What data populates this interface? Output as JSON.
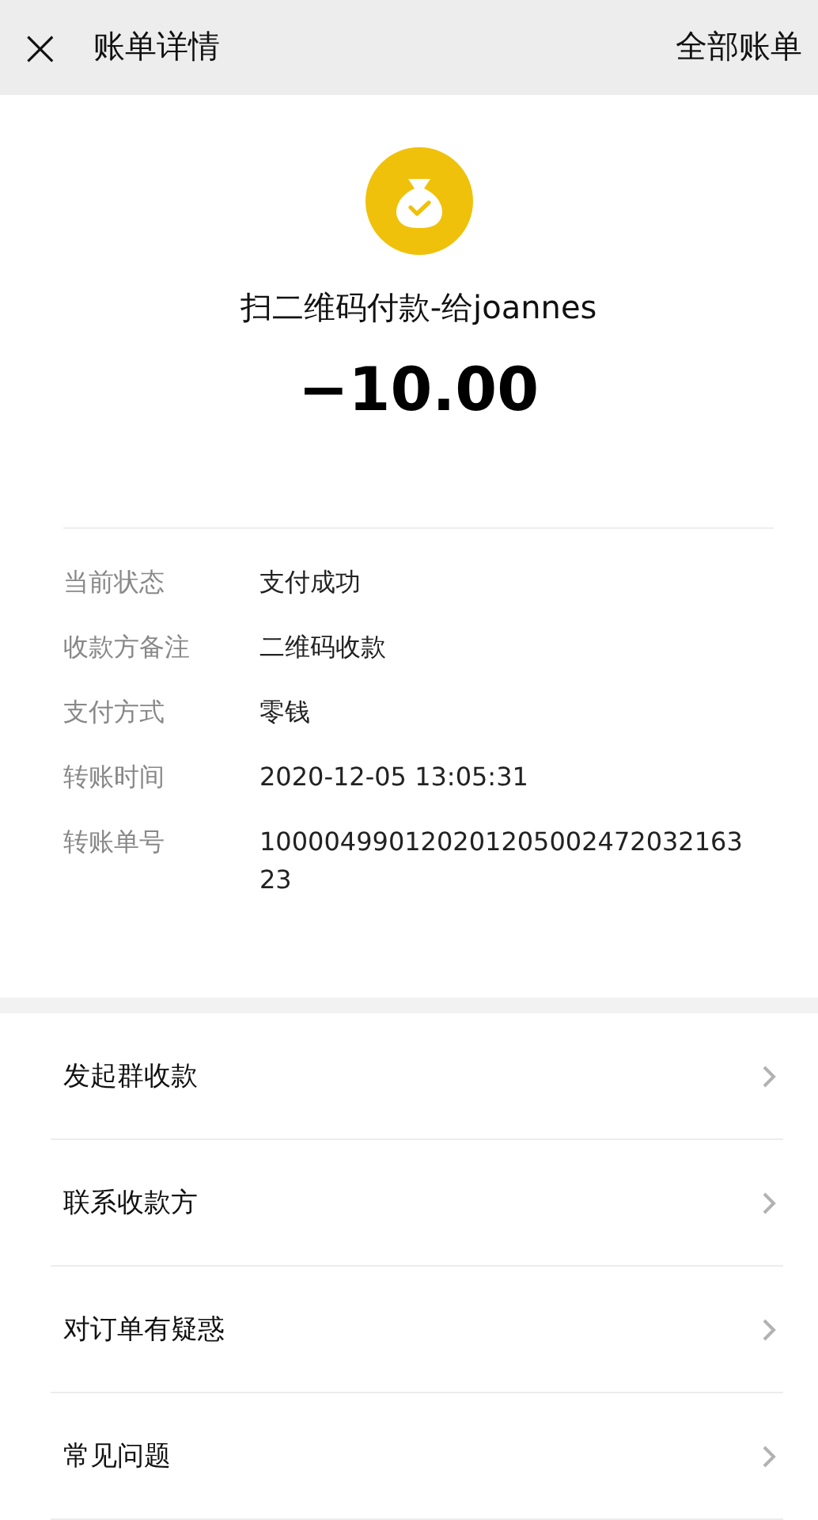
{
  "header": {
    "close_icon": "×",
    "title": "账单详情",
    "action": "全部账单"
  },
  "summary": {
    "title": "扫二维码付款-给joannes",
    "amount": "−10.00"
  },
  "details": [
    {
      "label": "当前状态",
      "value": "支付成功"
    },
    {
      "label": "收款方备注",
      "value": "二维码收款"
    },
    {
      "label": "支付方式",
      "value": "零钱"
    },
    {
      "label": "转账时间",
      "value": "2020-12-05 13:05:31"
    },
    {
      "label": "转账单号",
      "value": "10000499012020120500247203216323"
    }
  ],
  "menu": [
    {
      "label": "发起群收款"
    },
    {
      "label": "联系收款方"
    },
    {
      "label": "对订单有疑惑"
    },
    {
      "label": "常见问题"
    }
  ]
}
